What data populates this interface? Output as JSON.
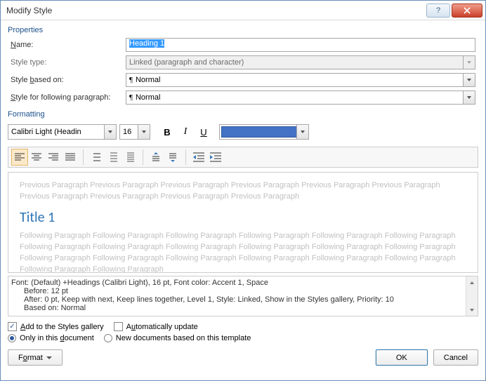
{
  "title": "Modify Style",
  "groups": {
    "properties": "Properties",
    "formatting": "Formatting"
  },
  "fields": {
    "name": {
      "label": "Name:",
      "value": "Heading 1"
    },
    "style_type": {
      "label": "Style type:",
      "value": "Linked (paragraph and character)"
    },
    "based_on": {
      "label": "Style based on:",
      "value": "Normal",
      "icon": "¶"
    },
    "following": {
      "label": "Style for following paragraph:",
      "value": "Normal",
      "icon": "¶"
    }
  },
  "format": {
    "font": "Calibri Light (Headin",
    "size": "16",
    "color": "#4472c4"
  },
  "preview": {
    "prev": "Previous Paragraph Previous Paragraph Previous Paragraph Previous Paragraph Previous Paragraph Previous Paragraph Previous Paragraph Previous Paragraph Previous Paragraph Previous Paragraph",
    "sample": "Title 1",
    "next": "Following Paragraph Following Paragraph Following Paragraph Following Paragraph Following Paragraph Following Paragraph Following Paragraph Following Paragraph Following Paragraph Following Paragraph Following Paragraph Following Paragraph Following Paragraph Following Paragraph Following Paragraph Following Paragraph Following Paragraph Following Paragraph Following Paragraph Following Paragraph"
  },
  "description": {
    "l1": "Font: (Default) +Headings (Calibri Light), 16 pt, Font color: Accent 1, Space",
    "l2": "Before:  12 pt",
    "l3": "After:  0 pt, Keep with next, Keep lines together, Level 1, Style: Linked, Show in the Styles gallery, Priority: 10",
    "l4": "Based on: Normal"
  },
  "checks": {
    "add_gallery": "Add to the Styles gallery",
    "auto_update": "Automatically update",
    "only_doc": "Only in this document",
    "new_docs": "New documents based on this template"
  },
  "buttons": {
    "format": "Format",
    "ok": "OK",
    "cancel": "Cancel"
  }
}
